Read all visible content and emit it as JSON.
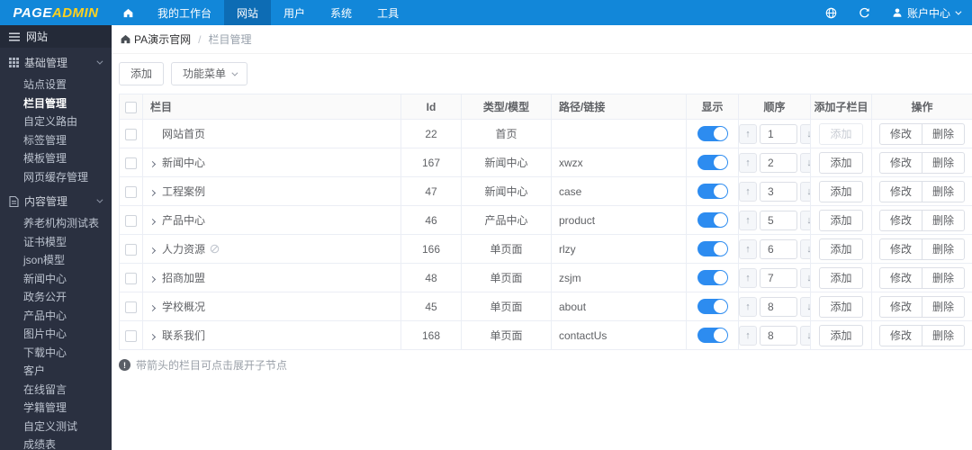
{
  "topbar": {
    "logo_part1": "PAGE",
    "logo_part2": "ADMIN",
    "nav": [
      {
        "label": "我的工作台",
        "active": false
      },
      {
        "label": "网站",
        "active": true
      },
      {
        "label": "用户",
        "active": false
      },
      {
        "label": "系统",
        "active": false
      },
      {
        "label": "工具",
        "active": false
      }
    ],
    "account_label": "账户中心"
  },
  "sidebar": {
    "header": "网站",
    "groups": [
      {
        "label": "基础管理",
        "icon": "grid-icon",
        "items": [
          "站点设置",
          "栏目管理",
          "自定义路由",
          "标签管理",
          "模板管理",
          "网页缓存管理"
        ],
        "active_item": "栏目管理"
      },
      {
        "label": "内容管理",
        "icon": "document-icon",
        "items": [
          "养老机构测试表",
          "证书模型",
          "json模型",
          "新闻中心",
          "政务公开",
          "产品中心",
          "图片中心",
          "下载中心",
          "客户",
          "在线留言",
          "学籍管理",
          "自定义测试",
          "成绩表"
        ],
        "active_item": ""
      }
    ]
  },
  "breadcrumb": {
    "site": "PA演示官网",
    "separator": "/",
    "page": "栏目管理"
  },
  "toolbar": {
    "add_label": "添加",
    "menu_label": "功能菜单"
  },
  "table": {
    "headers": [
      "栏目",
      "Id",
      "类型/模型",
      "路径/链接",
      "显示",
      "顺序",
      "添加子栏目",
      "操作"
    ],
    "actions": {
      "add": "添加",
      "edit": "修改",
      "delete": "删除"
    },
    "stepper": {
      "up": "↑",
      "down": "↓"
    },
    "rows": [
      {
        "name": "网站首页",
        "arrow": false,
        "hidden_icon": false,
        "id": "22",
        "type": "首页",
        "path": "",
        "visible": true,
        "order": "1",
        "add_disabled": true
      },
      {
        "name": "新闻中心",
        "arrow": true,
        "hidden_icon": false,
        "id": "167",
        "type": "新闻中心",
        "path": "xwzx",
        "visible": true,
        "order": "2",
        "add_disabled": false
      },
      {
        "name": "工程案例",
        "arrow": true,
        "hidden_icon": false,
        "id": "47",
        "type": "新闻中心",
        "path": "case",
        "visible": true,
        "order": "3",
        "add_disabled": false
      },
      {
        "name": "产品中心",
        "arrow": true,
        "hidden_icon": false,
        "id": "46",
        "type": "产品中心",
        "path": "product",
        "visible": true,
        "order": "5",
        "add_disabled": false
      },
      {
        "name": "人力资源",
        "arrow": true,
        "hidden_icon": true,
        "id": "166",
        "type": "单页面",
        "path": "rlzy",
        "visible": true,
        "order": "6",
        "add_disabled": false
      },
      {
        "name": "招商加盟",
        "arrow": true,
        "hidden_icon": false,
        "id": "48",
        "type": "单页面",
        "path": "zsjm",
        "visible": true,
        "order": "7",
        "add_disabled": false
      },
      {
        "name": "学校概况",
        "arrow": true,
        "hidden_icon": false,
        "id": "45",
        "type": "单页面",
        "path": "about",
        "visible": true,
        "order": "8",
        "add_disabled": false
      },
      {
        "name": "联系我们",
        "arrow": true,
        "hidden_icon": false,
        "id": "168",
        "type": "单页面",
        "path": "contactUs",
        "visible": true,
        "order": "8",
        "add_disabled": false
      }
    ]
  },
  "footnote": "带箭头的栏目可点击展开子节点",
  "colors": {
    "topbar_bg": "#1287d9",
    "topbar_active_bg": "#0d6cb4",
    "logo_accent": "#ffd21e",
    "sidebar_bg": "#2a3040",
    "toggle_on": "#2d8cf0",
    "table_border": "#ebeef5"
  }
}
